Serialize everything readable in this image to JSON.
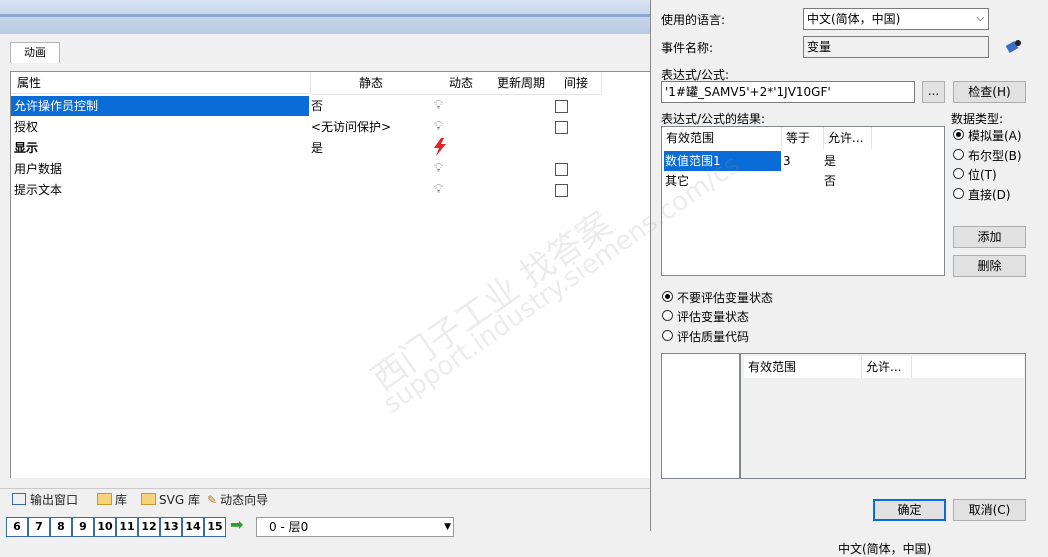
{
  "tabs": {
    "animation": "动画"
  },
  "property_table": {
    "headers": {
      "attribute": "属性",
      "static": "静态",
      "dynamic": "动态",
      "update_cycle": "更新周期",
      "indirect": "间接"
    },
    "rows": [
      {
        "name": "允许操作员控制",
        "static": "否",
        "dynamic_icon": "bulb-icon",
        "indirect": true
      },
      {
        "name": "授权",
        "static": "<无访问保护>",
        "dynamic_icon": "bulb-icon",
        "indirect": true
      },
      {
        "name": "显示",
        "static": "是",
        "dynamic_icon": "lightning-icon",
        "indirect": false
      },
      {
        "name": "用户数据",
        "static": "",
        "dynamic_icon": "bulb-icon",
        "indirect": true
      },
      {
        "name": "提示文本",
        "static": "",
        "dynamic_icon": "bulb-icon",
        "indirect": true
      }
    ]
  },
  "bottom_tabs": {
    "output": "输出窗口",
    "library": "库",
    "svg_library": "SVG 库",
    "wizard": "动态向导"
  },
  "layer_numbers": [
    "6",
    "7",
    "8",
    "9",
    "10",
    "11",
    "12",
    "13",
    "14",
    "15"
  ],
  "layer_select": {
    "value": "0 - 层0"
  },
  "dialog": {
    "language_label": "使用的语言:",
    "language_value": "中文(简体，中国)",
    "event_label": "事件名称:",
    "event_value": "变量",
    "expr_label": "表达式/公式:",
    "expr_value": "'1#罐_SAMV5'+2*'1JV10GF'",
    "ellipsis": "...",
    "check_button": "检查(H)",
    "result_label": "表达式/公式的结果:",
    "result_headers": {
      "range": "有效范围",
      "equal": "等于",
      "allow": "允许..."
    },
    "result_rows": [
      {
        "range": "数值范围1",
        "equal": "3",
        "allow": "是"
      },
      {
        "range": "其它",
        "equal": "",
        "allow": "否"
      }
    ],
    "datatype_label": "数据类型:",
    "datatype_options": [
      {
        "label": "模拟量(A)",
        "selected": true
      },
      {
        "label": "布尔型(B)",
        "selected": false
      },
      {
        "label": "位(T)",
        "selected": false
      },
      {
        "label": "直接(D)",
        "selected": false
      }
    ],
    "add_button": "添加",
    "delete_button": "删除",
    "status_options": [
      {
        "label": "不要评估变量状态",
        "selected": true
      },
      {
        "label": "评估变量状态",
        "selected": false
      },
      {
        "label": "评估质量代码",
        "selected": false
      }
    ],
    "lower_headers": {
      "range": "有效范围",
      "allow": "允许..."
    },
    "ok_button": "确定",
    "cancel_button": "取消(C)"
  },
  "statusbar": {
    "language": "中文(简体，中国)"
  },
  "watermark": {
    "line1": "西门子工业  找答案",
    "line2": "support.industry.siemens.com/cs"
  }
}
